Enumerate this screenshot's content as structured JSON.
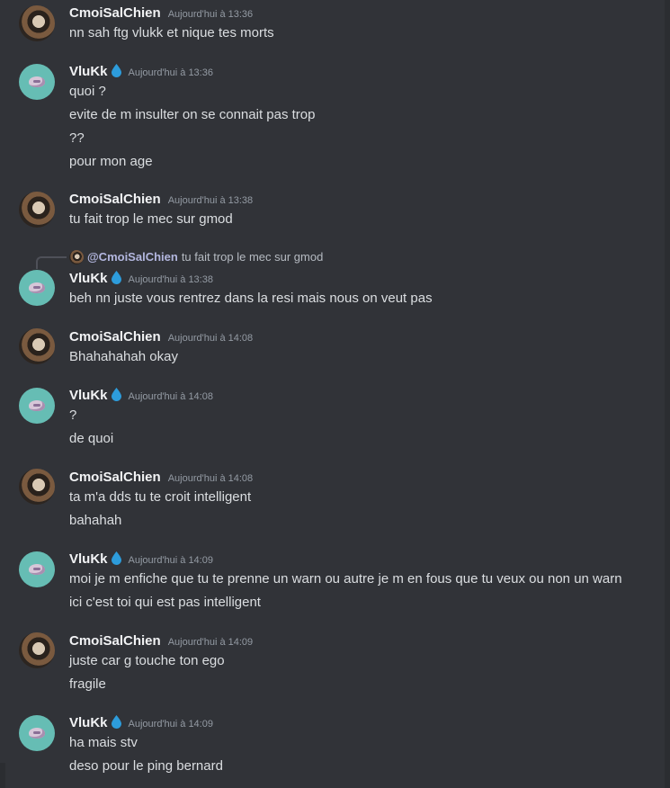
{
  "colors": {
    "background": "#313338",
    "username": "#f2f3f5",
    "text": "#dbdee1",
    "timestamp": "#949ba4",
    "vluk_avatar": "#66bdb4",
    "drop_icon": "#2d9cdb"
  },
  "messages": [
    {
      "author": "CmoiSalChien",
      "badge": "",
      "timestamp": "Aujourd'hui à 13:36",
      "lines": [
        "nn sah ftg vlukk et nique tes morts"
      ]
    },
    {
      "author": "VluKk",
      "badge": "drop-icon",
      "timestamp": "Aujourd'hui à 13:36",
      "lines": [
        "quoi ?",
        "evite de m insulter on se connait pas trop",
        "??",
        "pour mon age"
      ]
    },
    {
      "author": "CmoiSalChien",
      "badge": "",
      "timestamp": "Aujourd'hui à 13:38",
      "lines": [
        "tu fait trop le mec sur gmod"
      ]
    },
    {
      "author": "VluKk",
      "badge": "drop-icon",
      "timestamp": "Aujourd'hui à 13:38",
      "reply": {
        "mention": "@CmoiSalChien",
        "text": "tu fait trop le mec sur gmod"
      },
      "lines": [
        "beh nn juste vous rentrez dans la resi mais nous on veut pas"
      ]
    },
    {
      "author": "CmoiSalChien",
      "badge": "",
      "timestamp": "Aujourd'hui à 14:08",
      "lines": [
        "Bhahahahah okay"
      ]
    },
    {
      "author": "VluKk",
      "badge": "drop-icon",
      "timestamp": "Aujourd'hui à 14:08",
      "lines": [
        "?",
        "de quoi"
      ]
    },
    {
      "author": "CmoiSalChien",
      "badge": "",
      "timestamp": "Aujourd'hui à 14:08",
      "lines": [
        "ta m'a dds tu te croit intelligent",
        "bahahah"
      ]
    },
    {
      "author": "VluKk",
      "badge": "drop-icon",
      "timestamp": "Aujourd'hui à 14:09",
      "lines": [
        "moi je m enfiche que tu te prenne un warn ou autre je m en fous que tu veux ou non un warn",
        "ici c'est toi qui est pas intelligent"
      ]
    },
    {
      "author": "CmoiSalChien",
      "badge": "",
      "timestamp": "Aujourd'hui à 14:09",
      "lines": [
        "juste car g touche ton ego",
        "fragile"
      ]
    },
    {
      "author": "VluKk",
      "badge": "drop-icon",
      "timestamp": "Aujourd'hui à 14:09",
      "lines": [
        "ha mais stv",
        "deso pour le ping bernard"
      ]
    }
  ]
}
